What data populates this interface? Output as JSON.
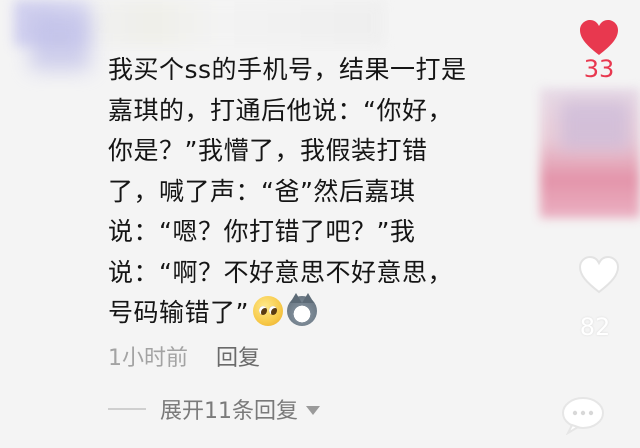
{
  "comment": {
    "lines": [
      "我买个ss的手机号，结果一打是",
      "嘉琪的，打通后他说：“你好，",
      "你是？”我懵了，我假装打错",
      "了，喊了声：“爸”然后嘉琪",
      "说：“嗯？你打错了吧？”我",
      "说：“啊？不好意思不好意思，",
      "号码输错了”"
    ],
    "emojis": [
      "pleading-face-emoji",
      "husky-dog-emoji"
    ]
  },
  "meta": {
    "time": "1小时前",
    "reply_label": "回复"
  },
  "expand": {
    "label": "展开11条回复"
  },
  "likes": {
    "comment_like_count": "33",
    "other_like_count": "82",
    "accent_color": "#e8384f"
  }
}
